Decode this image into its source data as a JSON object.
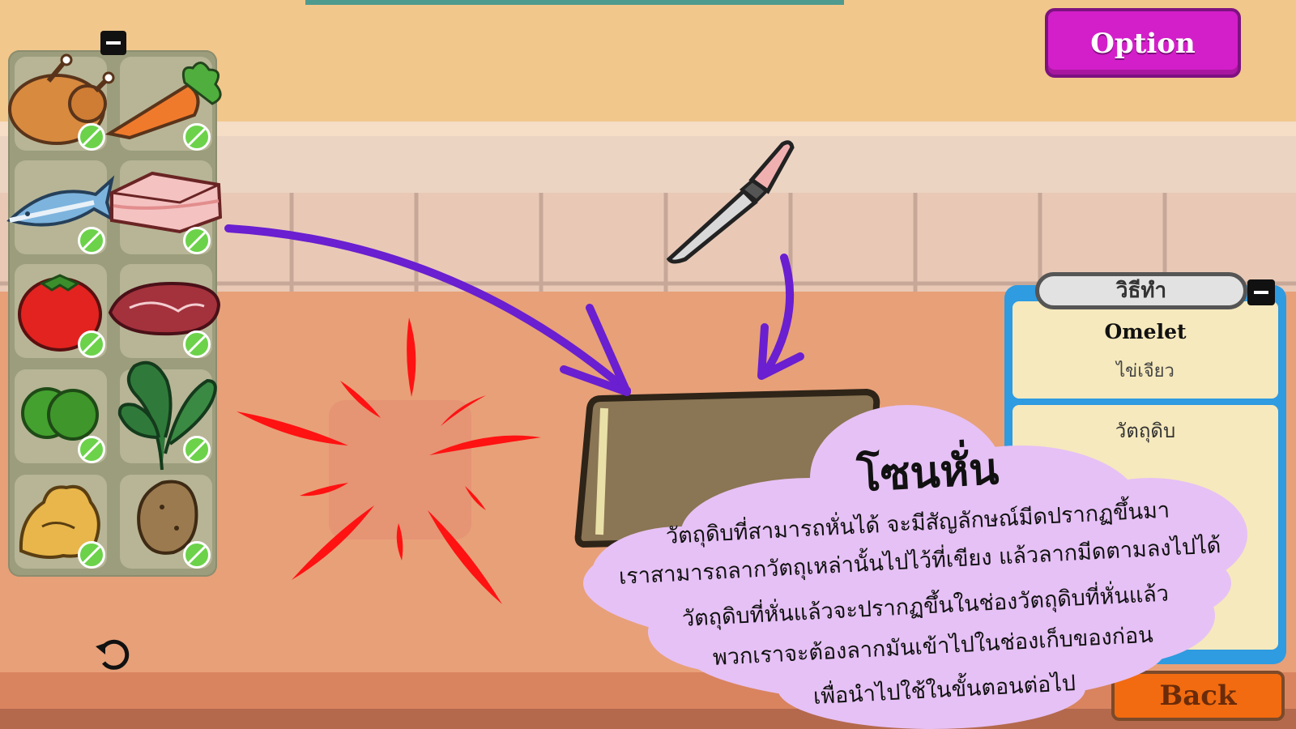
{
  "buttons": {
    "option_label": "Option",
    "back_label": "Back"
  },
  "ingredients": [
    {
      "name": "chicken-icon",
      "cuttable": true
    },
    {
      "name": "carrot-icon",
      "cuttable": true
    },
    {
      "name": "fish-icon",
      "cuttable": true
    },
    {
      "name": "pork-belly-icon",
      "cuttable": true
    },
    {
      "name": "tomato-icon",
      "cuttable": true
    },
    {
      "name": "beef-icon",
      "cuttable": true
    },
    {
      "name": "lime-icon",
      "cuttable": true
    },
    {
      "name": "spinach-icon",
      "cuttable": true
    },
    {
      "name": "ginger-icon",
      "cuttable": true
    },
    {
      "name": "potato-icon",
      "cuttable": true
    }
  ],
  "recipe": {
    "tab_label": "วิธีทำ",
    "dish_name_en": "Omelet",
    "dish_name_th": "ไข่เจียว",
    "ingredients_title": "วัตถุดิบ"
  },
  "tutorial": {
    "title": "โซนหั่น",
    "lines": [
      "วัตถุดิบที่สามารถหั่นได้ จะมีสัญลักษณ์มีดปรากฏขึ้นมา",
      "เราสามารถลากวัตถุเหล่านั้นไปไว้ที่เขียง แล้วลากมีดตามลงไปได้",
      "วัตถุดิบที่หั่นแล้วจะปรากฏขึ้นในช่องวัตถุดิบที่หั่นแล้ว",
      "พวกเราจะต้องลากมันเข้าไปในช่องเก็บของก่อน",
      "เพื่อนำไปใช้ในขั้นตอนต่อไป"
    ]
  },
  "colors": {
    "option_button": "#d31fc9",
    "back_button": "#f26b10",
    "arrow": "#6a1fd0",
    "burst": "#ff1010",
    "bubble": "#e6c1f5",
    "recipe_frame": "#2f9be0"
  }
}
